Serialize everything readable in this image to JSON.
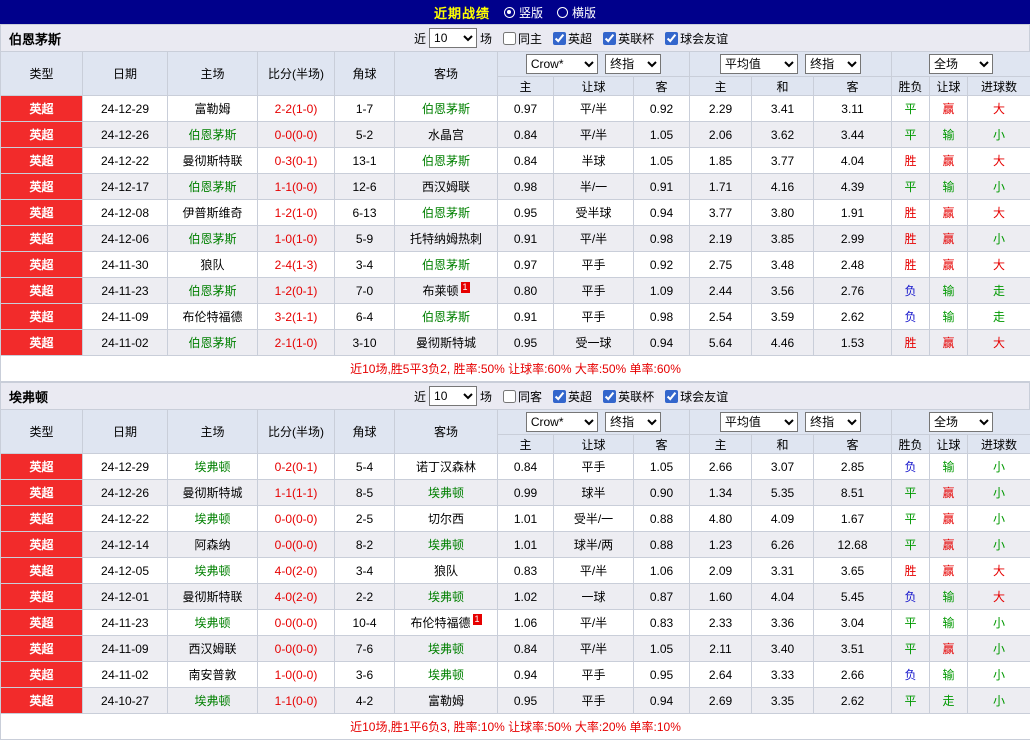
{
  "topbar": {
    "title": "近期战绩",
    "orientation_options": [
      {
        "label": "竖版",
        "selected": true
      },
      {
        "label": "横版",
        "selected": false
      }
    ]
  },
  "filter_labels": {
    "near": "近",
    "games": "场"
  },
  "header": {
    "left_cols": [
      "类型",
      "日期",
      "主场",
      "比分(半场)",
      "角球",
      "客场"
    ],
    "odds_cols": [
      "主",
      "让球",
      "客"
    ],
    "avg_cols": [
      "主",
      "和",
      "客"
    ],
    "result_cols": [
      "胜负",
      "让球",
      "进球数"
    ],
    "selects": {
      "odds_source": "Crow*",
      "odds_stage": "终指",
      "average": "平均值",
      "average_stage": "终指",
      "scope": "全场"
    }
  },
  "colors": {
    "topbar_bg": "#00008B",
    "title": "#FFFF00",
    "league_badge_bg": "#F22B2B",
    "focus_team": "#008000",
    "score": "#E60000",
    "summary": "#E60000",
    "result_map": {
      "胜": "#E60000",
      "平": "#009900",
      "负": "#1414CC",
      "赢": "#E60000",
      "输": "#009900",
      "走": "#009900",
      "大": "#E60000",
      "小": "#009900"
    }
  },
  "tables": [
    {
      "team": "伯恩茅斯",
      "filter": {
        "count": "10",
        "checkboxes": [
          {
            "label": "同主",
            "checked": false
          },
          {
            "label": "英超",
            "checked": true
          },
          {
            "label": "英联杯",
            "checked": true
          },
          {
            "label": "球会友谊",
            "checked": true
          }
        ]
      },
      "rows": [
        {
          "league": "英超",
          "date": "24-12-29",
          "home": "富勒姆",
          "score": "2-2(1-0)",
          "corners": "1-7",
          "away": "伯恩茅斯",
          "odds": [
            "0.97",
            "平/半",
            "0.92"
          ],
          "avg": [
            "2.29",
            "3.41",
            "3.11"
          ],
          "results": [
            "平",
            "赢",
            "大"
          ]
        },
        {
          "league": "英超",
          "date": "24-12-26",
          "home": "伯恩茅斯",
          "score": "0-0(0-0)",
          "corners": "5-2",
          "away": "水晶宫",
          "odds": [
            "0.84",
            "平/半",
            "1.05"
          ],
          "avg": [
            "2.06",
            "3.62",
            "3.44"
          ],
          "results": [
            "平",
            "输",
            "小"
          ]
        },
        {
          "league": "英超",
          "date": "24-12-22",
          "home": "曼彻斯特联",
          "score": "0-3(0-1)",
          "corners": "13-1",
          "away": "伯恩茅斯",
          "odds": [
            "0.84",
            "半球",
            "1.05"
          ],
          "avg": [
            "1.85",
            "3.77",
            "4.04"
          ],
          "results": [
            "胜",
            "赢",
            "大"
          ]
        },
        {
          "league": "英超",
          "date": "24-12-17",
          "home": "伯恩茅斯",
          "score": "1-1(0-0)",
          "corners": "12-6",
          "away": "西汉姆联",
          "odds": [
            "0.98",
            "半/一",
            "0.91"
          ],
          "avg": [
            "1.71",
            "4.16",
            "4.39"
          ],
          "results": [
            "平",
            "输",
            "小"
          ]
        },
        {
          "league": "英超",
          "date": "24-12-08",
          "home": "伊普斯维奇",
          "score": "1-2(1-0)",
          "corners": "6-13",
          "away": "伯恩茅斯",
          "odds": [
            "0.95",
            "受半球",
            "0.94"
          ],
          "avg": [
            "3.77",
            "3.80",
            "1.91"
          ],
          "results": [
            "胜",
            "赢",
            "大"
          ]
        },
        {
          "league": "英超",
          "date": "24-12-06",
          "home": "伯恩茅斯",
          "score": "1-0(1-0)",
          "corners": "5-9",
          "away": "托特纳姆热刺",
          "odds": [
            "0.91",
            "平/半",
            "0.98"
          ],
          "avg": [
            "2.19",
            "3.85",
            "2.99"
          ],
          "results": [
            "胜",
            "赢",
            "小"
          ]
        },
        {
          "league": "英超",
          "date": "24-11-30",
          "home": "狼队",
          "score": "2-4(1-3)",
          "corners": "3-4",
          "away": "伯恩茅斯",
          "odds": [
            "0.97",
            "平手",
            "0.92"
          ],
          "avg": [
            "2.75",
            "3.48",
            "2.48"
          ],
          "results": [
            "胜",
            "赢",
            "大"
          ]
        },
        {
          "league": "英超",
          "date": "24-11-23",
          "home": "伯恩茅斯",
          "score": "1-2(0-1)",
          "corners": "7-0",
          "away": "布莱顿",
          "away_badge": "1",
          "odds": [
            "0.80",
            "平手",
            "1.09"
          ],
          "avg": [
            "2.44",
            "3.56",
            "2.76"
          ],
          "results": [
            "负",
            "输",
            "走"
          ]
        },
        {
          "league": "英超",
          "date": "24-11-09",
          "home": "布伦特福德",
          "score": "3-2(1-1)",
          "corners": "6-4",
          "away": "伯恩茅斯",
          "odds": [
            "0.91",
            "平手",
            "0.98"
          ],
          "avg": [
            "2.54",
            "3.59",
            "2.62"
          ],
          "results": [
            "负",
            "输",
            "走"
          ]
        },
        {
          "league": "英超",
          "date": "24-11-02",
          "home": "伯恩茅斯",
          "score": "2-1(1-0)",
          "corners": "3-10",
          "away": "曼彻斯特城",
          "odds": [
            "0.95",
            "受一球",
            "0.94"
          ],
          "avg": [
            "5.64",
            "4.46",
            "1.53"
          ],
          "results": [
            "胜",
            "赢",
            "大"
          ]
        }
      ],
      "summary": "近10场,胜5平3负2, 胜率:50% 让球率:60% 大率:50% 单率:60%"
    },
    {
      "team": "埃弗顿",
      "filter": {
        "count": "10",
        "checkboxes": [
          {
            "label": "同客",
            "checked": false
          },
          {
            "label": "英超",
            "checked": true
          },
          {
            "label": "英联杯",
            "checked": true
          },
          {
            "label": "球会友谊",
            "checked": true
          }
        ]
      },
      "rows": [
        {
          "league": "英超",
          "date": "24-12-29",
          "home": "埃弗顿",
          "score": "0-2(0-1)",
          "corners": "5-4",
          "away": "诺丁汉森林",
          "odds": [
            "0.84",
            "平手",
            "1.05"
          ],
          "avg": [
            "2.66",
            "3.07",
            "2.85"
          ],
          "results": [
            "负",
            "输",
            "小"
          ]
        },
        {
          "league": "英超",
          "date": "24-12-26",
          "home": "曼彻斯特城",
          "score": "1-1(1-1)",
          "corners": "8-5",
          "away": "埃弗顿",
          "odds": [
            "0.99",
            "球半",
            "0.90"
          ],
          "avg": [
            "1.34",
            "5.35",
            "8.51"
          ],
          "results": [
            "平",
            "赢",
            "小"
          ]
        },
        {
          "league": "英超",
          "date": "24-12-22",
          "home": "埃弗顿",
          "score": "0-0(0-0)",
          "corners": "2-5",
          "away": "切尔西",
          "odds": [
            "1.01",
            "受半/一",
            "0.88"
          ],
          "avg": [
            "4.80",
            "4.09",
            "1.67"
          ],
          "results": [
            "平",
            "赢",
            "小"
          ]
        },
        {
          "league": "英超",
          "date": "24-12-14",
          "home": "阿森纳",
          "score": "0-0(0-0)",
          "corners": "8-2",
          "away": "埃弗顿",
          "odds": [
            "1.01",
            "球半/两",
            "0.88"
          ],
          "avg": [
            "1.23",
            "6.26",
            "12.68"
          ],
          "results": [
            "平",
            "赢",
            "小"
          ]
        },
        {
          "league": "英超",
          "date": "24-12-05",
          "home": "埃弗顿",
          "score": "4-0(2-0)",
          "corners": "3-4",
          "away": "狼队",
          "odds": [
            "0.83",
            "平/半",
            "1.06"
          ],
          "avg": [
            "2.09",
            "3.31",
            "3.65"
          ],
          "results": [
            "胜",
            "赢",
            "大"
          ]
        },
        {
          "league": "英超",
          "date": "24-12-01",
          "home": "曼彻斯特联",
          "score": "4-0(2-0)",
          "corners": "2-2",
          "away": "埃弗顿",
          "odds": [
            "1.02",
            "一球",
            "0.87"
          ],
          "avg": [
            "1.60",
            "4.04",
            "5.45"
          ],
          "results": [
            "负",
            "输",
            "大"
          ]
        },
        {
          "league": "英超",
          "date": "24-11-23",
          "home": "埃弗顿",
          "score": "0-0(0-0)",
          "corners": "10-4",
          "away": "布伦特福德",
          "away_badge": "1",
          "odds": [
            "1.06",
            "平/半",
            "0.83"
          ],
          "avg": [
            "2.33",
            "3.36",
            "3.04"
          ],
          "results": [
            "平",
            "输",
            "小"
          ]
        },
        {
          "league": "英超",
          "date": "24-11-09",
          "home": "西汉姆联",
          "score": "0-0(0-0)",
          "corners": "7-6",
          "away": "埃弗顿",
          "odds": [
            "0.84",
            "平/半",
            "1.05"
          ],
          "avg": [
            "2.11",
            "3.40",
            "3.51"
          ],
          "results": [
            "平",
            "赢",
            "小"
          ]
        },
        {
          "league": "英超",
          "date": "24-11-02",
          "home": "南安普敦",
          "score": "1-0(0-0)",
          "corners": "3-6",
          "away": "埃弗顿",
          "odds": [
            "0.94",
            "平手",
            "0.95"
          ],
          "avg": [
            "2.64",
            "3.33",
            "2.66"
          ],
          "results": [
            "负",
            "输",
            "小"
          ]
        },
        {
          "league": "英超",
          "date": "24-10-27",
          "home": "埃弗顿",
          "score": "1-1(0-0)",
          "corners": "4-2",
          "away": "富勒姆",
          "odds": [
            "0.95",
            "平手",
            "0.94"
          ],
          "avg": [
            "2.69",
            "3.35",
            "2.62"
          ],
          "results": [
            "平",
            "走",
            "小"
          ]
        }
      ],
      "summary": "近10场,胜1平6负3, 胜率:10% 让球率:50% 大率:20% 单率:10%"
    }
  ]
}
